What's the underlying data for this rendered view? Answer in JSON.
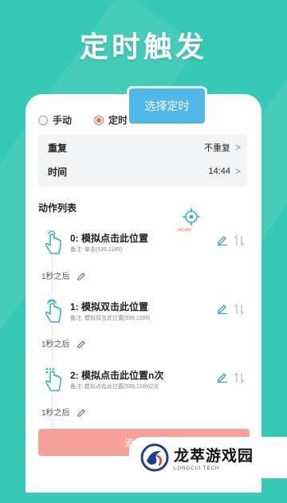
{
  "hero": {
    "title": "定时触发"
  },
  "mode": {
    "options": [
      {
        "label": "手动",
        "selected": false
      },
      {
        "label": "定时",
        "selected": true
      }
    ]
  },
  "tooltip": {
    "label": "选择定时"
  },
  "settings": {
    "repeat": {
      "label": "重复",
      "value": "不重复"
    },
    "time": {
      "label": "时间",
      "value": "14:44"
    }
  },
  "actions_section": {
    "title": "动作列表",
    "coord_tag": "540,800"
  },
  "actions": [
    {
      "title": "0: 模拟点击此位置",
      "note": "备注:  单击(539,1189)",
      "delay": "1秒之后"
    },
    {
      "title": "1: 模拟双击此位置",
      "note": "备注:  模拟双击此位置(539,1189)",
      "delay": "1秒之后"
    },
    {
      "title": "2: 模拟点击此位置n次",
      "note": "备注:  模拟点击此位置(539,1189)2次",
      "delay": "1秒之后"
    }
  ],
  "bottom_button": {
    "label": "添"
  },
  "brand": {
    "name": "龙萃游戏园",
    "sub": "LONGCUI TECH"
  },
  "colors": {
    "background": "#36c9b5",
    "accent_red": "#ef6a5b",
    "tooltip_blue": "#4fb8e8",
    "icon_teal": "#33b7a6"
  }
}
